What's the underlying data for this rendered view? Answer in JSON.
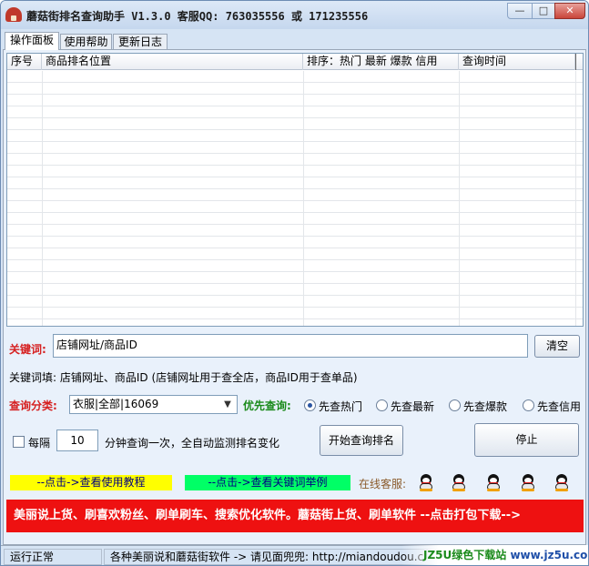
{
  "window": {
    "title": "蘑菇街排名查询助手 V1.3.0 客服QQ: 763035556 或 171235556",
    "min_glyph": "—",
    "max_glyph": "□",
    "close_glyph": "✕"
  },
  "tabs": [
    {
      "label": "操作面板",
      "active": true
    },
    {
      "label": "使用帮助",
      "active": false
    },
    {
      "label": "更新日志",
      "active": false
    }
  ],
  "table": {
    "columns": [
      "序号",
      "商品排名位置",
      "排序：热门  最新  爆款  信用",
      "查询时间"
    ],
    "rows": []
  },
  "form": {
    "keyword_label": "关键词:",
    "keyword_value": "店铺网址/商品ID",
    "clear_button": "清空",
    "hint": "关键词填: 店铺网址、商品ID (店铺网址用于查全店，商品ID用于查单品)",
    "category_label": "查询分类:",
    "category_value": "衣服|全部|16069",
    "priority_label": "优先查询:",
    "radios": [
      {
        "label": "先查热门",
        "checked": true
      },
      {
        "label": "先查最新",
        "checked": false
      },
      {
        "label": "先查爆款",
        "checked": false
      },
      {
        "label": "先查信用",
        "checked": false
      }
    ],
    "interval_checkbox_label": "每隔",
    "interval_checked": false,
    "interval_value": "10",
    "interval_suffix": "分钟查询一次，全自动监测排名变化",
    "start_button": "开始查询排名",
    "stop_button": "停止"
  },
  "links": {
    "tutorial": "--点击->查看使用教程",
    "keyword_example": "--点击->查看关键词举例",
    "online_service": "在线客服:"
  },
  "ad_banner": "美丽说上货、刷喜欢粉丝、刷单刷车、搜索优化软件。蘑菇街上货、刷单软件 --点击打包下载-->",
  "status": {
    "state": "运行正常",
    "message": "各种美丽说和蘑菇街软件 -> 请见面兜兜: http://miandoudou.c"
  },
  "watermark": {
    "part1": "JZ5U绿色下载站",
    "part2": "www.jz5u.com"
  }
}
